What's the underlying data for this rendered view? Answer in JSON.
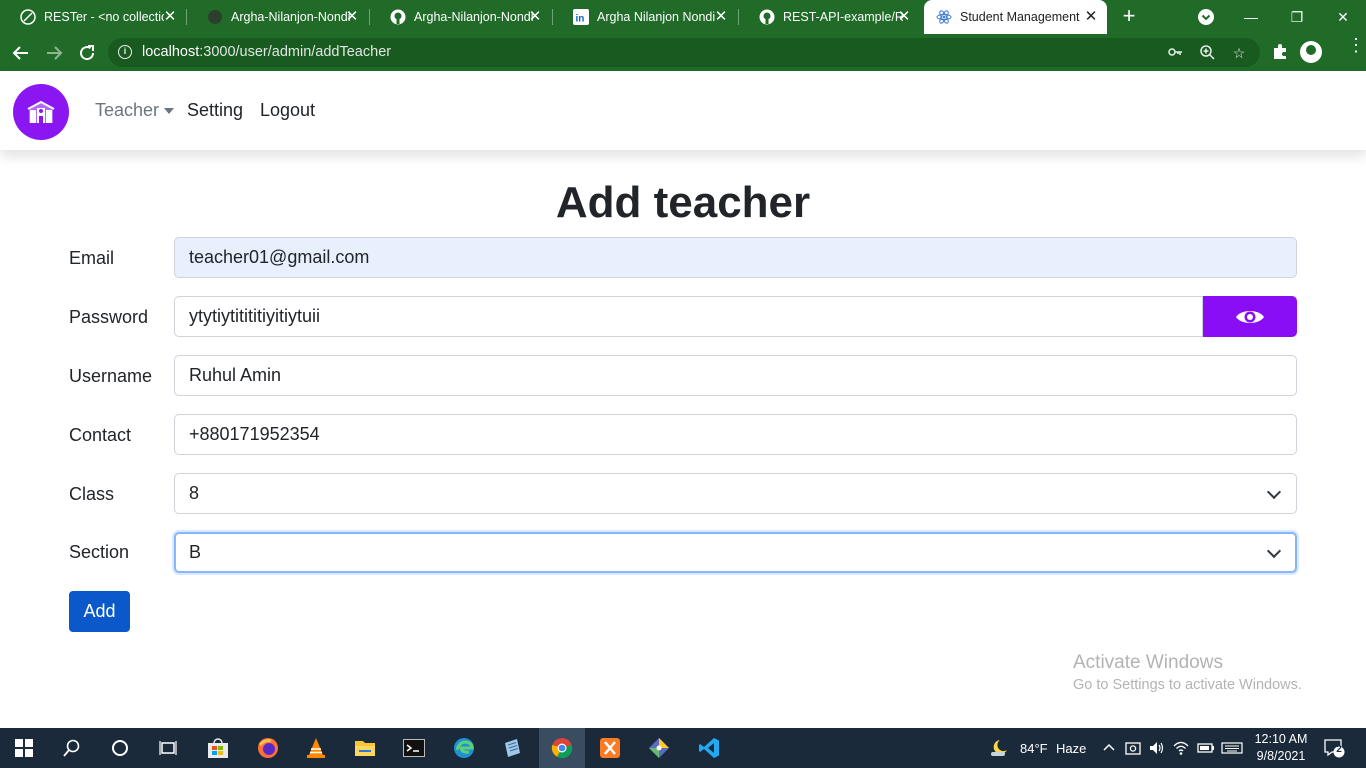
{
  "browser": {
    "tabs": [
      {
        "title": "RESTer - <no collectio",
        "icon": "rester-icon"
      },
      {
        "title": "Argha-Nilanjon-Nondi",
        "icon": "github-icon"
      },
      {
        "title": "Argha-Nilanjon-Nondi",
        "icon": "github-icon"
      },
      {
        "title": "Argha Nilanjon Nondi",
        "icon": "linkedin-icon"
      },
      {
        "title": "REST-API-example/RE",
        "icon": "github-icon"
      },
      {
        "title": "Student Management",
        "icon": "react-icon",
        "active": true
      }
    ],
    "new_tab": "+",
    "url_host": "localhost",
    "url_path": ":3000/user/admin/addTeacher"
  },
  "app": {
    "nav": {
      "teacher": "Teacher",
      "setting": "Setting",
      "logout": "Logout"
    },
    "title": "Add teacher",
    "form": {
      "email_label": "Email",
      "email_value": "teacher01@gmail.com",
      "password_label": "Password",
      "password_value": "ytytiytitititiyitiytuii",
      "username_label": "Username",
      "username_value": "Ruhul Amin",
      "contact_label": "Contact",
      "contact_value": "+880171952354",
      "class_label": "Class",
      "class_value": "8",
      "section_label": "Section",
      "section_value": "B",
      "submit": "Add"
    }
  },
  "watermark": {
    "line1": "Activate Windows",
    "line2": "Go to Settings to activate Windows."
  },
  "taskbar": {
    "weather_temp": "84°F",
    "weather_desc": "Haze",
    "time": "12:10 AM",
    "date": "9/8/2021",
    "notification_count": "2"
  },
  "colors": {
    "chrome_frame": "#1f6b27",
    "brand_purple": "#8a17f2",
    "eye_button": "#8a0ef5",
    "add_button": "#0a58ca",
    "autofill_bg": "#e8f0fe",
    "taskbar_bg": "#1b2a3a"
  }
}
